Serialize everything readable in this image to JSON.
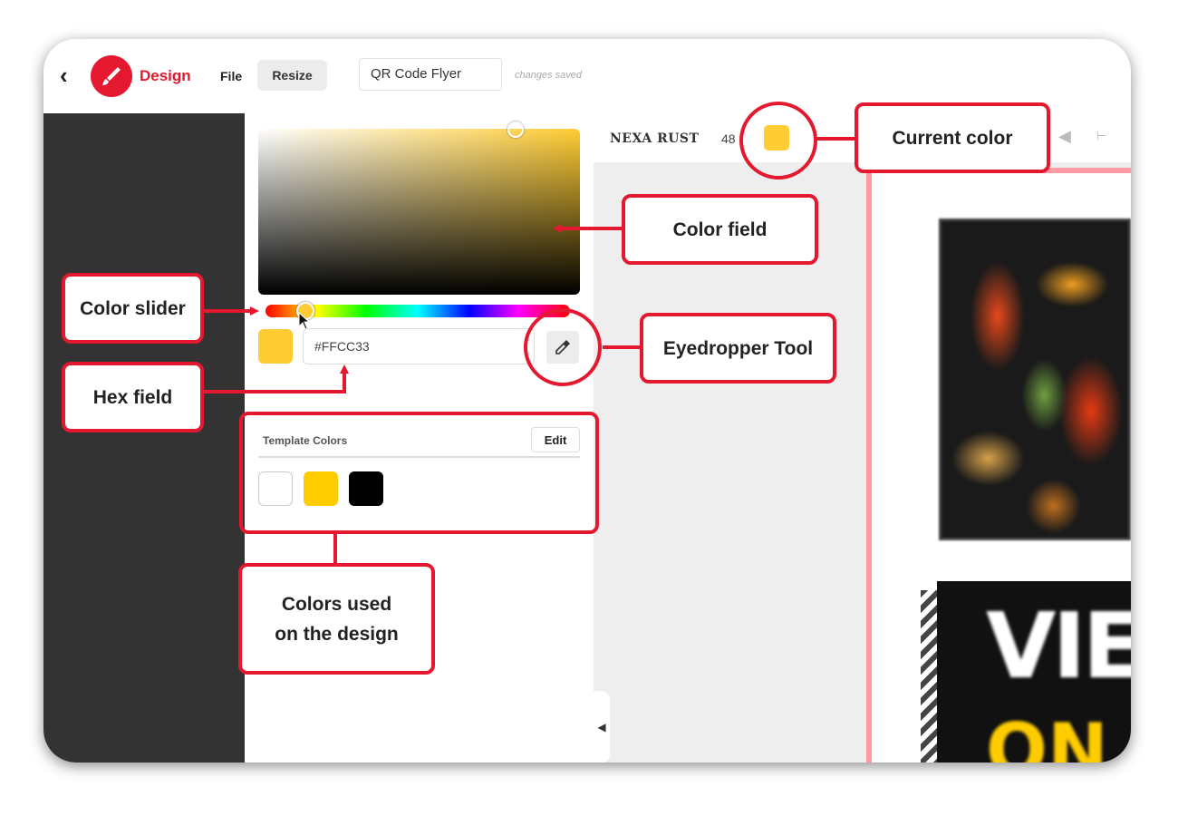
{
  "app": {
    "name": "Design",
    "back_icon": "chevron-left-icon",
    "logo_icon": "brush-icon",
    "menu": {
      "file": "File",
      "resize": "Resize"
    },
    "document_name": "QR Code Flyer",
    "save_status": "changes saved"
  },
  "color_picker": {
    "hex_value": "#FFCC33",
    "current_color": "#FFCC33",
    "eyedropper_icon": "eyedropper-icon",
    "template_colors": {
      "title": "Template Colors",
      "edit_label": "Edit",
      "swatches": [
        "#FFFFFF",
        "#FFCC00",
        "#000000"
      ]
    }
  },
  "toolbar": {
    "font_name": "NEXA RUST",
    "font_size": "48"
  },
  "canvas": {
    "promo_text_line1": "VIEW",
    "promo_text_line2": "ON"
  },
  "annotations": {
    "current_color": "Current color",
    "color_field": "Color field",
    "color_slider": "Color slider",
    "eyedropper_tool": "Eyedropper Tool",
    "hex_field": "Hex field",
    "colors_used_line1": "Colors used",
    "colors_used_line2": "on the design"
  },
  "colors": {
    "accent": "#E4192F",
    "rail": "#333333"
  }
}
